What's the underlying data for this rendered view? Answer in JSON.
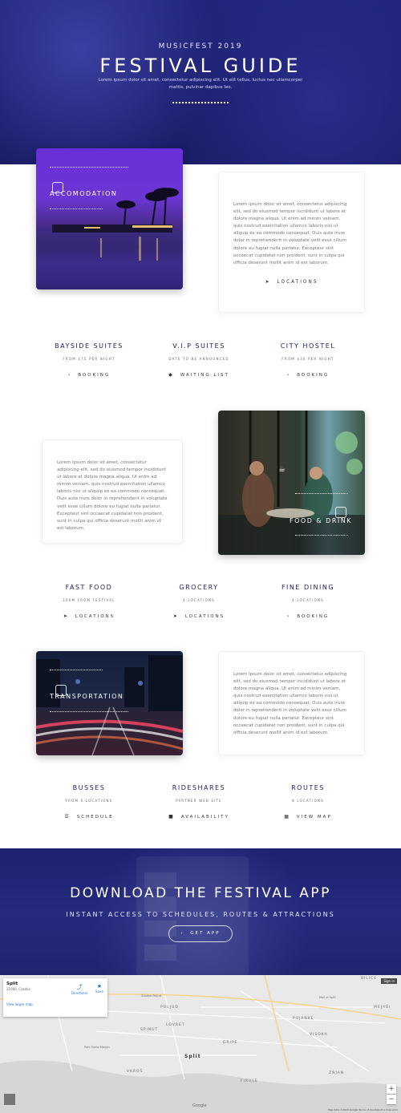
{
  "hero": {
    "kicker": "MUSICFEST 2019",
    "title": "FESTIVAL GUIDE",
    "subtitle": "Lorem ipsum dolor sit amet, consectetur adipiscing elit. Ut elit tellus, luctus nec ullamcorper mattis, pulvinar dapibus leo."
  },
  "lorem": "Lorem ipsum dolor sit amet, consectetur adipiscing elit, sed do eiusmod tempor incididunt ut labore et dolore magna aliqua. Ut enim ad minim veniam, quis nostrud exercitation ullamco laboris nisi ut aliquip ex ea commodo consequat. Duis aute irure dolor in reprehenderit in voluptate velit esse cillum dolore eu fugiat nulla pariatur. Excepteur sint occaecat cupidatat non proident, sunt in culpa qui officia deserunt mollit anim id est laborum.",
  "sections": [
    {
      "overlay_title": "ACCOMODATION",
      "link": "LOCATIONS",
      "columns": [
        {
          "title": "BAYSIDE SUITES",
          "meta": "FROM $75 PER NIGHT",
          "action": "BOOKING",
          "icon": "chevron-right-icon"
        },
        {
          "title": "V.I.P SUITES",
          "meta": "DATE TO BE ANNOUNCED",
          "action": "WAITING LIST",
          "icon": "tag-icon"
        },
        {
          "title": "CITY HOSTEL",
          "meta": "FROM $30 PER NIGHT",
          "action": "BOOKING",
          "icon": "chevron-right-icon"
        }
      ]
    },
    {
      "overlay_title": "FOOD & DRINK",
      "columns": [
        {
          "title": "FAST FOOD",
          "meta": "100M FROM FESTIVAL",
          "action": "LOCATIONS",
          "icon": "location-arrow-icon"
        },
        {
          "title": "GROCERY",
          "meta": "4 LOCATIONS",
          "action": "LOCATIONS",
          "icon": "location-arrow-icon"
        },
        {
          "title": "FINE DINING",
          "meta": "4 LOCATIONS",
          "action": "BOOKING",
          "icon": "chevron-right-icon"
        }
      ]
    },
    {
      "overlay_title": "TRANSPORTATION",
      "columns": [
        {
          "title": "BUSSES",
          "meta": "FROM 6 LOCATIONS",
          "action": "SCHEDULE",
          "icon": "list-icon"
        },
        {
          "title": "RIDESHARES",
          "meta": "PARTNER WEB SITE",
          "action": "AVAILABILITY",
          "icon": "car-icon"
        },
        {
          "title": "ROUTES",
          "meta": "8 LOCATIONS",
          "action": "VIEW MAP",
          "icon": "map-icon"
        }
      ]
    }
  ],
  "app": {
    "title": "DOWNLOAD THE FESTIVAL APP",
    "tagline": "INSTANT ACCESS TO SCHEDULES, ROUTES & ATTRACTIONS",
    "button": "GET APP"
  },
  "map": {
    "place": "Split",
    "place_sub": "21000, Croatia",
    "directions": "Directions",
    "save": "Save",
    "larger": "View larger map",
    "signin": "Sign in",
    "labels": [
      "BILICE",
      "MEJAŠI",
      "POLJUD",
      "LOVRET",
      "SPINUT",
      "GRIPE",
      "PUJANKE",
      "VISOKA",
      "VAROŠ",
      "ZNJAN",
      "FIRULE",
      "Split",
      "Park Šuma Marjan",
      "Mall of Split",
      "Stadion Poljud"
    ],
    "attribution": "Map data ©2019 Google   Terms of Use   Report a map error",
    "google": "Google"
  }
}
